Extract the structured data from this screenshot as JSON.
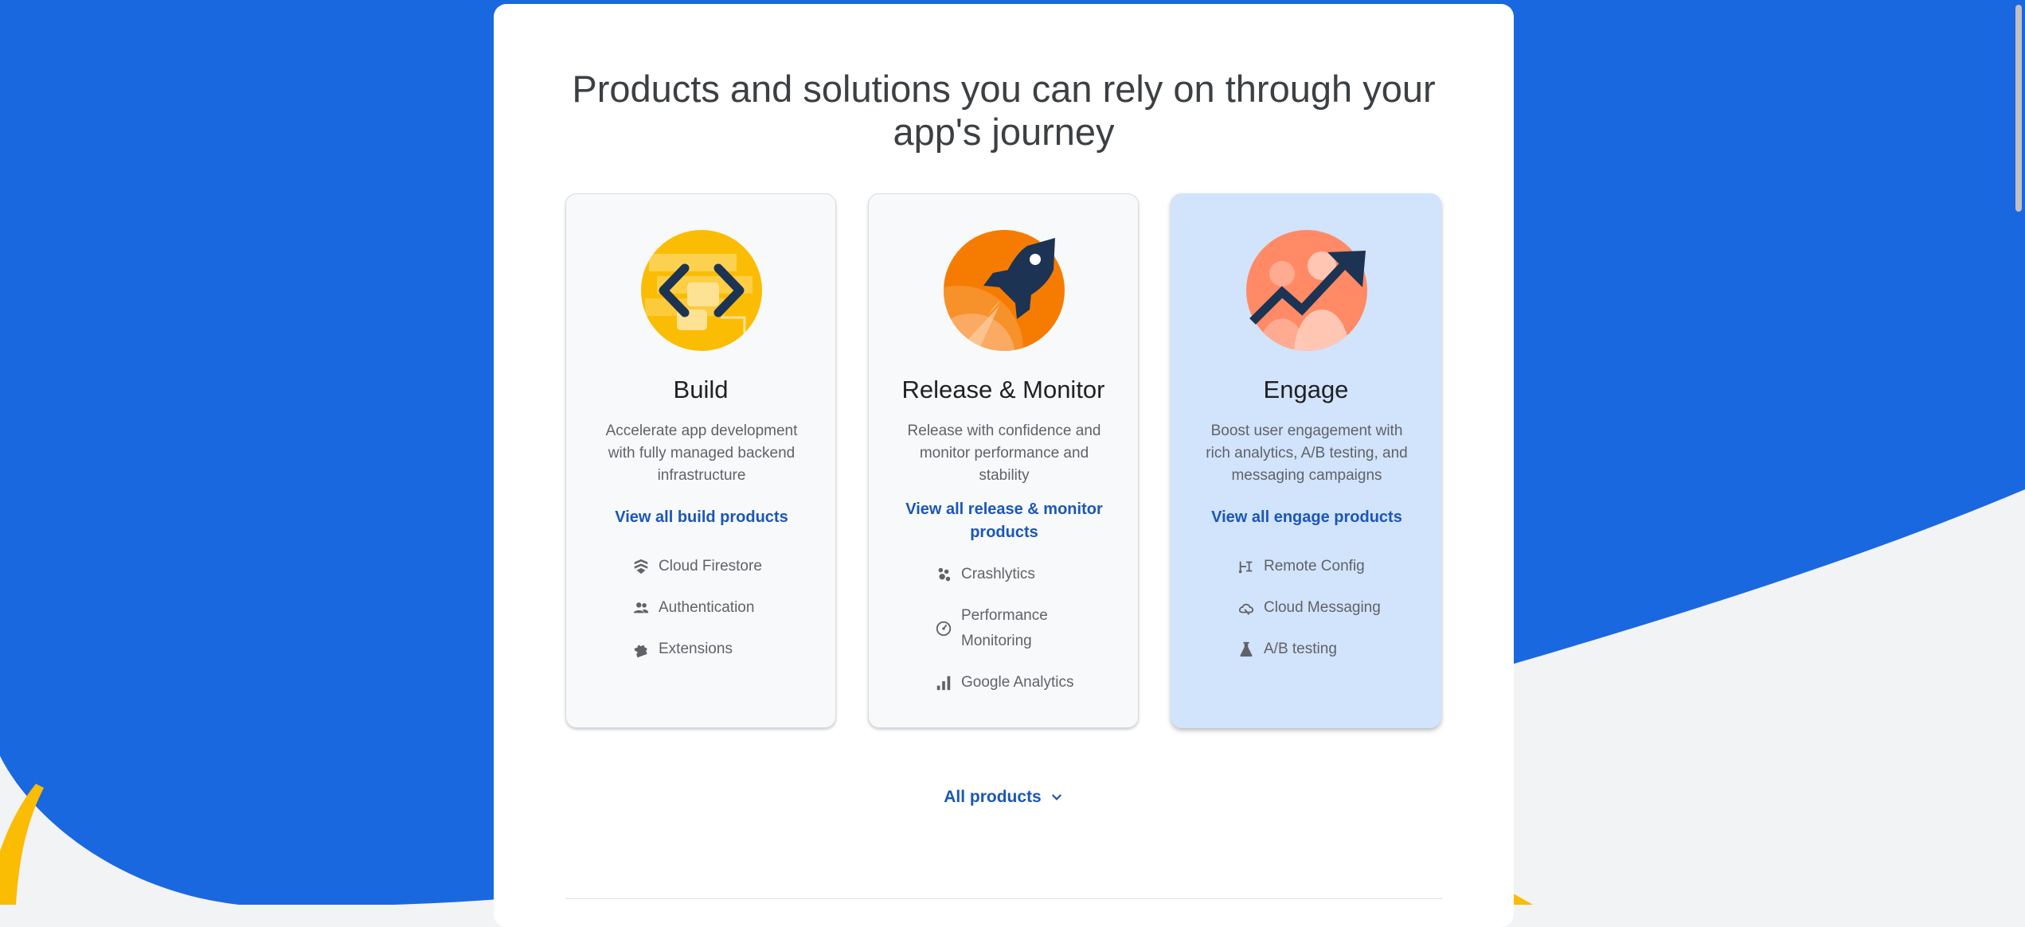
{
  "colors": {
    "blue_bg": "#1a68e0",
    "yellow_accent": "#fbbc04",
    "panel": "#ffffff",
    "link": "#1a57b8",
    "active_card": "#d2e3fc"
  },
  "section": {
    "headline_line1": "Products and solutions you can rely on through your",
    "headline_line2": "app's journey"
  },
  "cards": [
    {
      "icon": "build-code-icon",
      "title": "Build",
      "desc_line1": "Accelerate app development",
      "desc_line2": "with fully managed backend",
      "desc_line3": "infrastructure",
      "link": "View all build products",
      "features": [
        {
          "icon": "firestore-icon",
          "label": "Cloud Firestore"
        },
        {
          "icon": "people-icon",
          "label": "Authentication"
        },
        {
          "icon": "puzzle-icon",
          "label": "Extensions"
        }
      ]
    },
    {
      "icon": "rocket-icon",
      "title": "Release & Monitor",
      "desc_line1": "Release with confidence and",
      "desc_line2": "monitor performance and",
      "desc_line3": "stability",
      "link_line1": "View all release & monitor",
      "link_line2": "products",
      "features": [
        {
          "icon": "crashlytics-icon",
          "label": "Crashlytics"
        },
        {
          "icon": "speedometer-icon",
          "label_line1": "Performance",
          "label_line2": "Monitoring"
        },
        {
          "icon": "bar-chart-icon",
          "label": "Google Analytics"
        }
      ]
    },
    {
      "icon": "trending-up-icon",
      "title": "Engage",
      "desc_line1": "Boost user engagement with",
      "desc_line2": "rich analytics, A/B testing, and",
      "desc_line3": "messaging campaigns",
      "link": "View all engage products",
      "features": [
        {
          "icon": "remote-config-icon",
          "label": "Remote Config"
        },
        {
          "icon": "cloud-messaging-icon",
          "label": "Cloud Messaging"
        },
        {
          "icon": "flask-icon",
          "label": "A/B testing"
        }
      ]
    }
  ],
  "footer": {
    "all_products_label": "All products",
    "all_products_icon": "chevron-down-icon"
  }
}
